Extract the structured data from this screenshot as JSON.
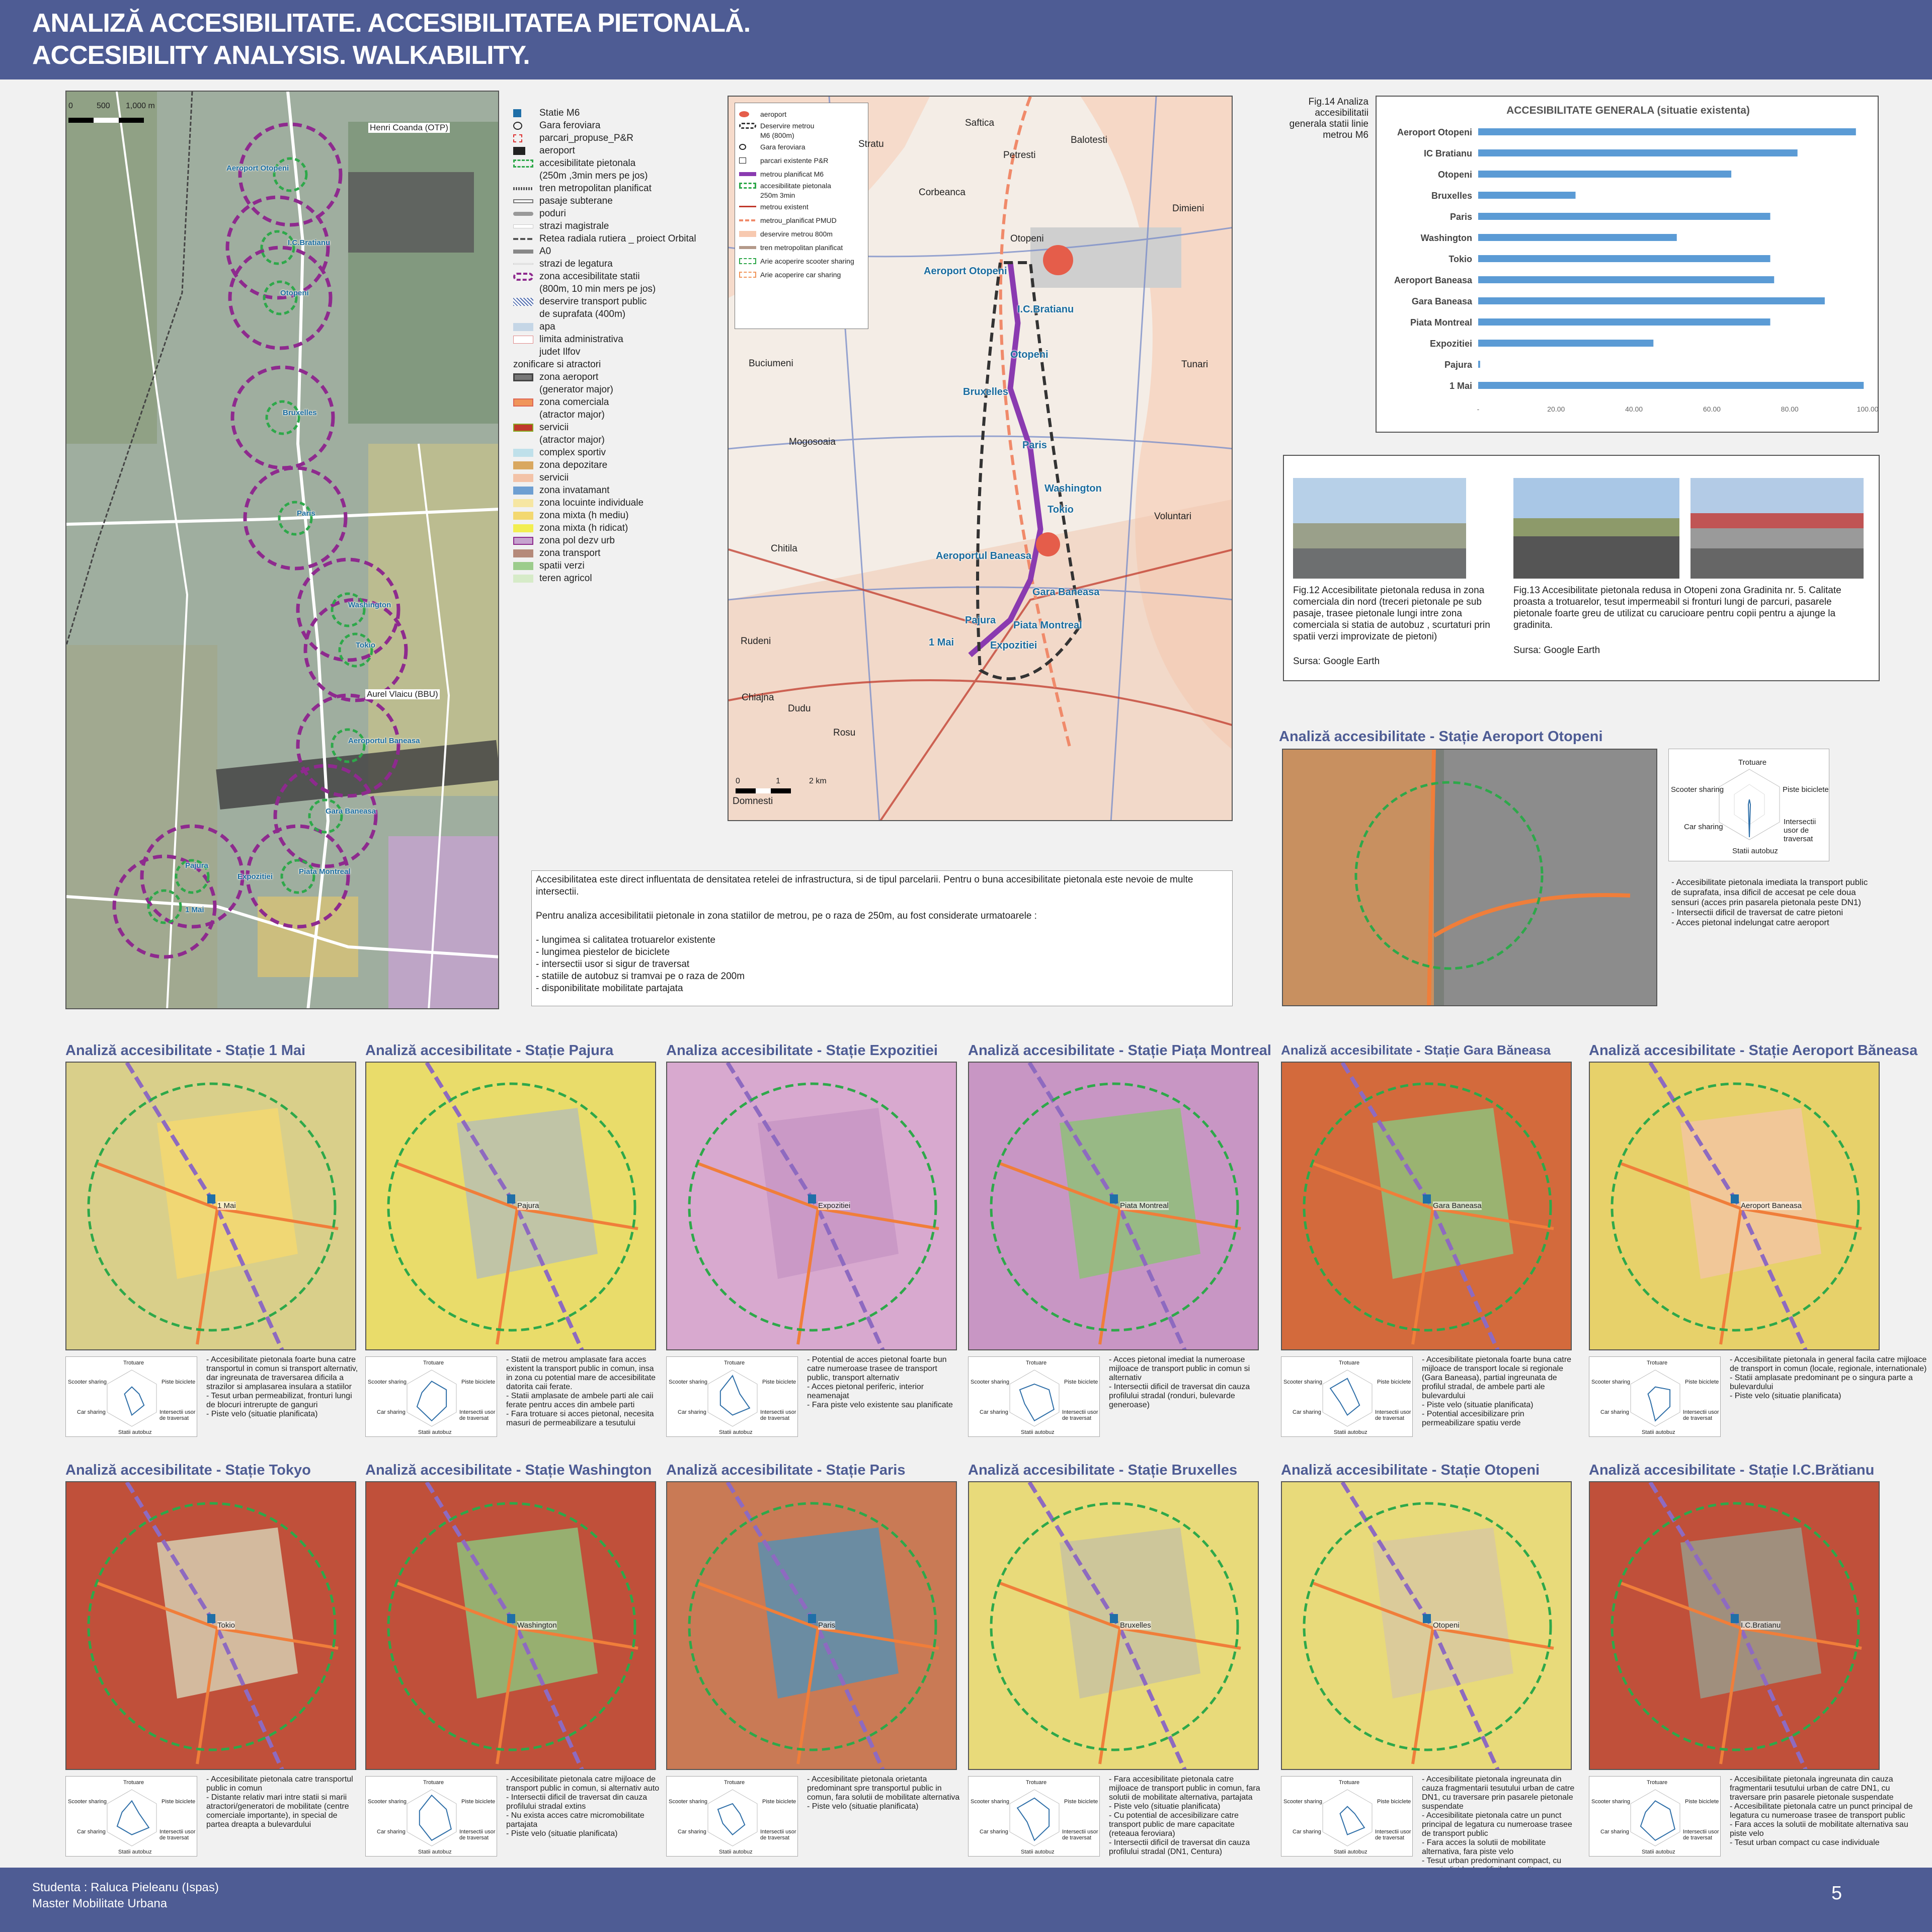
{
  "header": {
    "line1": "ANALIZĂ ACCESIBILITATE. ACCESIBILITATEA PIETONALĂ.",
    "line2": "ACCESIBILITY ANALYSIS. WALKABILITY."
  },
  "footer": {
    "student": "Studenta : Raluca Pieleanu (Ispas)",
    "program": "Master Mobilitate Urbana",
    "page": "5"
  },
  "left_map": {
    "scale": [
      "0",
      "500",
      "1,000 m"
    ],
    "airports": [
      "Henri Coanda (OTP)",
      "Aurel Vlaicu (BBU)"
    ],
    "stations": [
      "Aeroport Otopeni",
      "I.C.Bratianu",
      "Otopeni",
      "Bruxelles",
      "Paris",
      "Washington",
      "Tokio",
      "Aeroportul Baneasa",
      "Gara Baneasa",
      "Piata Montreal",
      "Expozitiei",
      "Pajura",
      "1 Mai"
    ],
    "legend": [
      "Statie M6",
      "Gara feroviara",
      "parcari_propuse_P&R",
      "aeroport",
      "accesibilitate pietonala",
      "(250m ,3min mers pe jos)",
      "tren metropolitan planificat",
      "pasaje subterane",
      "poduri",
      "strazi magistrale",
      "Retea radiala rutiera _ proiect Orbital",
      "A0",
      "strazi de legatura",
      "zona accesibilitate statii",
      "(800m, 10 min mers pe jos)",
      "deservire transport public",
      "de suprafata (400m)",
      "apa",
      "limita administrativa",
      "judet Ilfov",
      "zonificare si atractori",
      "zona aeroport",
      "(generator major)",
      "zona comerciala",
      "(atractor major)",
      "servicii",
      "(atractor major)",
      "complex sportiv",
      "zona depozitare",
      "servicii",
      "zona invatamant",
      "zona locuinte individuale",
      "zona mixta (h mediu)",
      "zona mixta (h ridicat)",
      "zona pol dezv urb",
      "zona transport",
      "spatii verzi",
      "teren agricol"
    ]
  },
  "center_map": {
    "legend": [
      "aeroport",
      "Deservire metrou",
      "M6 (800m)",
      "Gara feroviara",
      "parcari existente P&R",
      "metrou planificat M6",
      "accesibilitate pietonala",
      "250m 3min",
      "metrou existent",
      "metrou_planificat PMUD",
      "deservire metrou 800m",
      "tren metropolitan planificat",
      "Arie acoperire scooter sharing",
      "Arie acoperire car sharing"
    ],
    "places": [
      "Saftica",
      "Balotesti",
      "Stratu",
      "Petresti",
      "Corbeanca",
      "Dimieni",
      "Otopeni",
      "Buciumeni",
      "Tunari",
      "Mogosoaia",
      "Voluntari",
      "Chitila",
      "Rudeni",
      "Chiajna",
      "Dudu",
      "Rosu",
      "Domnesti"
    ],
    "stations": [
      "Aeroport Otopeni",
      "I.C.Bratianu",
      "Otopeni",
      "Bruxelles",
      "Paris",
      "Washington",
      "Tokio",
      "Aeroportul Baneasa",
      "Gara Baneasa",
      "Piata Montreal",
      "Pajura",
      "1 Mai",
      "Expozitiei"
    ],
    "scale": [
      "0",
      "1",
      "2 km"
    ]
  },
  "fig14_caption": "Fig.14 Analiza accesibilitatii generala statii linie metrou M6",
  "chart_data": {
    "type": "bar",
    "title": "ACCESIBILITATE GENERALA (situatie existenta)",
    "categories": [
      "Aeroport Otopeni",
      "IC Bratianu",
      "Otopeni",
      "Bruxelles",
      "Paris",
      "Washington",
      "Tokio",
      "Aeroport Baneasa",
      "Gara Baneasa",
      "Piata Montreal",
      "Expozitiei",
      "Pajura",
      "1 Mai"
    ],
    "values": [
      97,
      82,
      65,
      25,
      75,
      51,
      75,
      76,
      89,
      75,
      45,
      0.5,
      99
    ],
    "xticks": [
      "-",
      "20.00",
      "40.00",
      "60.00",
      "80.00",
      "100.00"
    ],
    "xlim": [
      0,
      100
    ],
    "color": "#5b9bd5",
    "grid": false
  },
  "photos": {
    "fig12": "Fig.12 Accesibilitate pietonala redusa in zona comerciala din nord (treceri pietonale pe sub pasaje, trasee pietonale lungi intre zona comerciala si statia de autobuz , scurtaturi prin spatii verzi improvizate de pietoni)",
    "fig12_src": "Sursa: Google Earth",
    "fig13": "Fig.13 Accesibilitate pietonala redusa in Otopeni zona Gradinita nr. 5. Calitate proasta a trotuarelor, tesut impermeabil si fronturi lungi de parcuri, pasarele pietonale foarte greu de utilizat cu carucioare pentru copii pentru a ajunge la gradinita.",
    "fig13_src": "Sursa: Google Earth"
  },
  "intro": {
    "p1": "Accesibilitatea este direct influentata de densitatea retelei de infrastructura, si de tipul parcelarii. Pentru o buna accesibilitate pietonala este nevoie de multe intersectii.",
    "p2": "Pentru analiza accesibilitatii pietonale in zona statiilor de metrou, pe o raza de 250m, au fost considerate urmatoarele :",
    "items": [
      "- lungimea si calitatea trotuarelor existente",
      "- lungimea piestelor de biciclete",
      "- intersectii usor si sigur de traversat",
      "- statiile de autobuz si tramvai pe o raza de 200m",
      "- disponibilitate mobilitate partajata"
    ]
  },
  "radar_labels": {
    "top": "Trotuare",
    "tr": "Piste biciclete",
    "br": "Intersectii usor de traversat",
    "bottom": "Statii autobuz",
    "bl": "Car sharing",
    "tl": "Scooter sharing"
  },
  "big_station": {
    "title": "Analiză accesibilitate - Stație Aeroport Otopeni",
    "notes": [
      "- Accesibilitate pietonala imediata la transport public de suprafata, insa dificil de accesat pe cele doua sensuri (acces prin pasarela pietonala peste DN1)",
      "- Intersectii dificil de traversat de catre pietoni",
      "- Acces pietonal indelungat catre aeroport"
    ]
  },
  "stations_row1": [
    {
      "title": "Analiză accesibilitate - Stație 1 Mai",
      "label": "1 Mai",
      "notes": [
        "- Accesibilitate pietonala foarte buna catre transportul in comun si transport alternativ, dar ingreunata de traversarea dificila a strazilor si amplasarea insulara a statiilor",
        "- Tesut urban permeabilizat, fronturi lungi de blocuri intrerupte de ganguri",
        "- Piste velo (situatie planificata)"
      ]
    },
    {
      "title": "Analiză accesibilitate - Stație Pajura",
      "label": "Pajura",
      "notes": [
        "- Statii de metrou amplasate fara acces existent la transport public in comun, insa in zona cu potential mare de accesibilitate datorita caii ferate.",
        "- Statii amplasate de ambele parti ale caii ferate pentru acces din ambele parti",
        "- Fara trotuare si acces pietonal, necesita masuri de permeabilizare a tesutului"
      ]
    },
    {
      "title": "Analiza accesibilitate - Stație Expozitiei",
      "label": "Expozitiei",
      "notes": [
        "- Potential de acces pietonal foarte bun catre numeroase trasee de transport public, transport alternativ",
        "- Acces pietonal periferic, interior neamenajat",
        "- Fara piste velo existente sau planificate"
      ]
    },
    {
      "title": "Analiză accesibilitate - Stație Piața Montreal",
      "label": "Piata Montreal",
      "notes": [
        "- Acces pietonal imediat la numeroase mijloace de transport public in comun si alternativ",
        "- Intersectii dificil de traversat din cauza profilului stradal (ronduri, bulevarde generoase)"
      ]
    },
    {
      "title": "Analiză accesibilitate - Stație Gara Băneasa",
      "label": "Gara Baneasa",
      "notes": [
        "- Accesibilitate pietonala foarte buna catre mijloace de transport locale si regionale (Gara Baneasa), partial ingreunata de profilul stradal, de ambele parti ale bulevardului",
        "- Piste velo (situatie planificata)",
        "- Potential accesibilizare prin permeabilizare spatiu verde"
      ]
    },
    {
      "title": "Analiză accesibilitate - Stație Aeroport Băneasa",
      "label": "Aeroport Baneasa",
      "notes": [
        "- Accesibilitate pietonala in general facila catre mijloace de transport in comun (locale, regionale, internationale)",
        "- Statii amplasate predominant pe o singura parte a bulevardului",
        "- Piste velo (situatie planificata)"
      ]
    }
  ],
  "stations_row2": [
    {
      "title": "Analiză accesibilitate - Stație Tokyo",
      "label": "Tokio",
      "notes": [
        "- Accesibilitate pietonala catre transportul public in comun",
        "- Distante relativ mari intre statii si marii atractori/generatori de mobilitate (centre comerciale importante), in special de partea dreapta a bulevardului"
      ]
    },
    {
      "title": "Analiză accesibilitate - Stație Washington",
      "label": "Washington",
      "notes": [
        "- Accesibilitate pietonala catre mijloace de transport public in comun, si alternativ auto",
        "- Intersectii dificil de traversat din cauza profilului stradal extins",
        "- Nu exista acces catre micromobilitate partajata",
        "- Piste velo (situatie planificata)"
      ]
    },
    {
      "title": "Analiză accesibilitate - Stație Paris",
      "label": "Paris",
      "notes": [
        "- Accesibilitate pietonala orietanta predominant spre transportul public in comun, fara solutii de mobilitate alternativa",
        "- Piste velo (situatie planificata)"
      ]
    },
    {
      "title": "Analiză accesibilitate - Stație Bruxelles",
      "label": "Bruxelles",
      "notes": [
        "- Fara accesibilitate pietonala catre mijloace de transport public in comun, fara solutii de mobilitate alternativa, partajata",
        "- Piste velo (situatie planificata)",
        "- Cu potential de accesibilizare catre transport public de mare capacitate (reteaua feroviara)",
        "- Intersectii dificil de traversat din cauza profilului stradal (DN1, Centura)"
      ]
    },
    {
      "title": "Analiză accesibilitate - Stație Otopeni",
      "label": "Otopeni",
      "notes": [
        "- Accesibilitate pietonala ingreunata din cauza fragmentarii tesutului urban de catre DN1, cu traversare prin pasarele pietonale suspendate",
        "- Accesibilitate pietonala catre un punct principal de legatura cu numeroase trasee de transport public",
        "- Fara acces la solutii de mobilitate alternativa, fara piste velo",
        "- Tesut urban predominant compact, cu case individuale, dificil de ocolit sau traversat"
      ]
    },
    {
      "title": "Analiză accesibilitate - Stație I.C.Brătianu",
      "label": "I.C.Bratianu",
      "notes": [
        "- Accesibilitate pietonala ingreunata din cauza fragmentarii tesutului urban de catre DN1, cu traversare prin pasarele pietonale suspendate",
        "- Accesibilitate pietonala catre un punct principal de legatura cu numeroase trasee de transport public",
        "- Fara acces la solutii de mobilitate alternativa sau piste velo",
        "- Tesut urban compact cu case individuale"
      ]
    }
  ]
}
